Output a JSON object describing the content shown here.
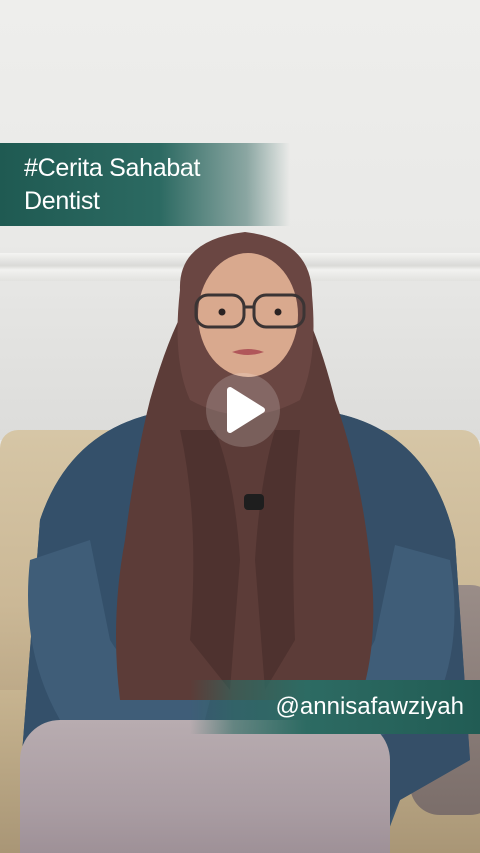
{
  "video": {
    "caption": {
      "line1": "#Cerita Sahabat",
      "line2": "Dentist"
    },
    "handle": "@annisafawziyah",
    "play_icon": "play-icon",
    "colors": {
      "caption_bg": "#215c54",
      "text": "#ffffff",
      "hijab": "#5a3a36",
      "jacket": "#3a5670"
    }
  }
}
